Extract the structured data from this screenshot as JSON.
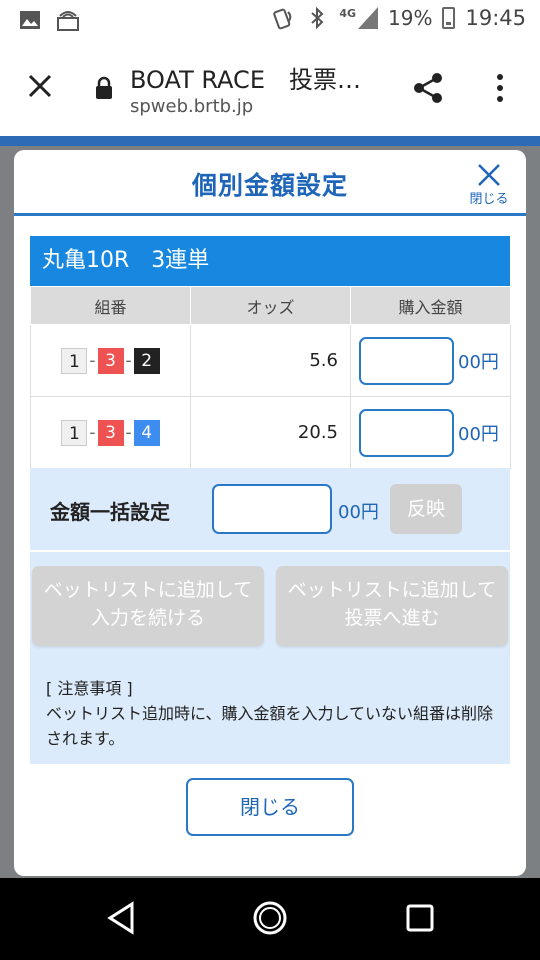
{
  "status_bar": {
    "network": "4G",
    "battery": "19%",
    "time": "19:45"
  },
  "browser": {
    "title": "BOAT RACE　投票…",
    "url": "spweb.brtb.jp"
  },
  "modal": {
    "title": "個別金額設定",
    "close_label": "閉じる",
    "race_label": "丸亀10R　3連単",
    "columns": [
      "組番",
      "オッズ",
      "購入金額"
    ],
    "rows": [
      {
        "boats": [
          "1",
          "3",
          "2"
        ],
        "odds": "5.6",
        "amount_suffix": "00円"
      },
      {
        "boats": [
          "1",
          "3",
          "4"
        ],
        "odds": "20.5",
        "amount_suffix": "00円"
      }
    ],
    "bulk": {
      "label": "金額一括設定",
      "suffix": "00円",
      "apply_label": "反映"
    },
    "actions": {
      "continue_line1": "ベットリストに追加して",
      "continue_line2": "入力を続ける",
      "proceed_line1": "ベットリストに追加して",
      "proceed_line2": "投票へ進む"
    },
    "notice": {
      "heading": "[ 注意事項 ]",
      "body": "ベットリスト追加時に、購入金額を入力していない組番は削除されます。"
    },
    "close_button": "閉じる"
  }
}
